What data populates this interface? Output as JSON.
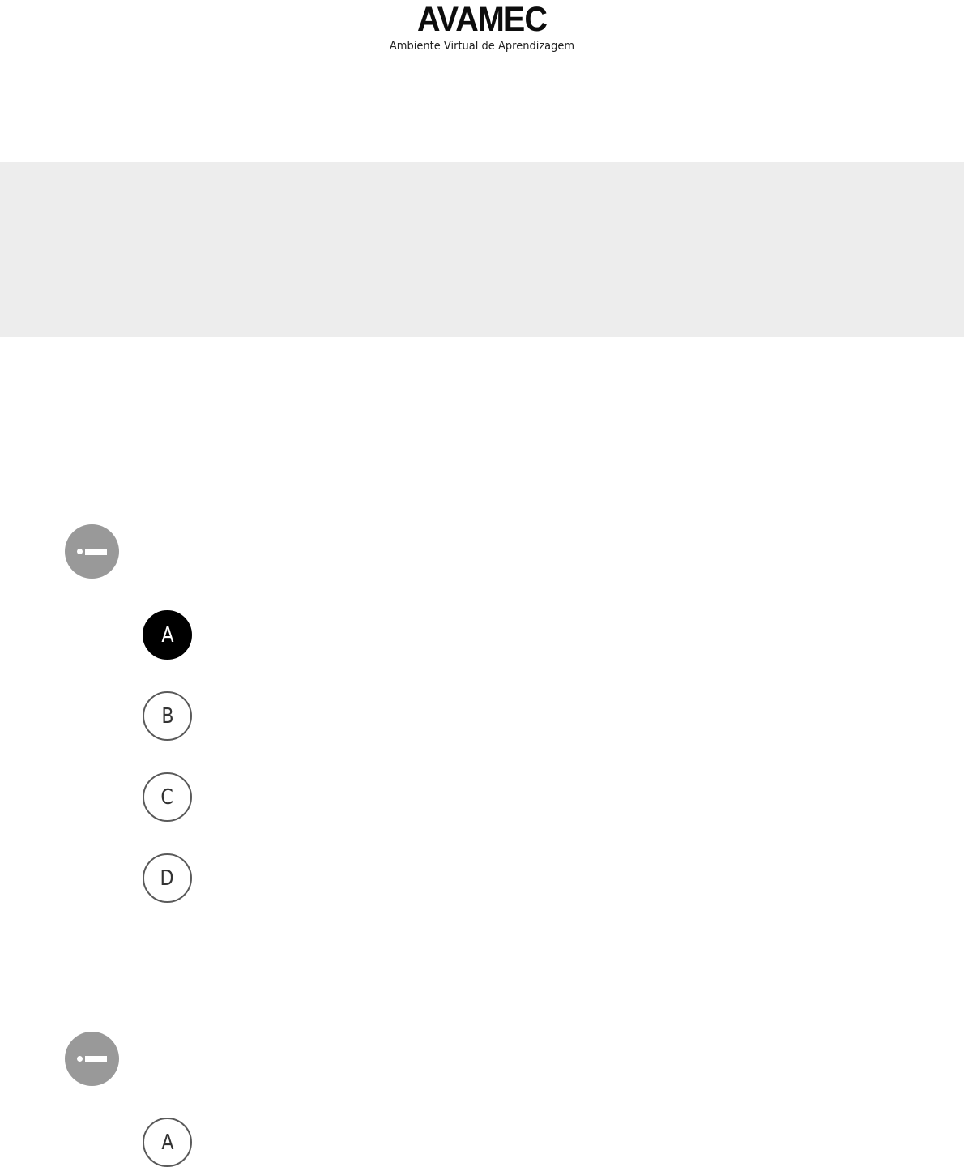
{
  "header": {
    "logo_text": "AVAMEC",
    "subtitle": "Ambiente Virtual de Aprendizagem"
  },
  "questions": [
    {
      "icon": "question-marker-icon",
      "options": [
        {
          "letter": "A",
          "selected": true
        },
        {
          "letter": "B",
          "selected": false
        },
        {
          "letter": "C",
          "selected": false
        },
        {
          "letter": "D",
          "selected": false
        }
      ]
    },
    {
      "icon": "question-marker-icon",
      "options": [
        {
          "letter": "A",
          "selected": false
        }
      ]
    }
  ],
  "colors": {
    "banner": "#ededed",
    "marker": "#999999",
    "selected": "#000000",
    "option_border": "#5a5a5a"
  }
}
